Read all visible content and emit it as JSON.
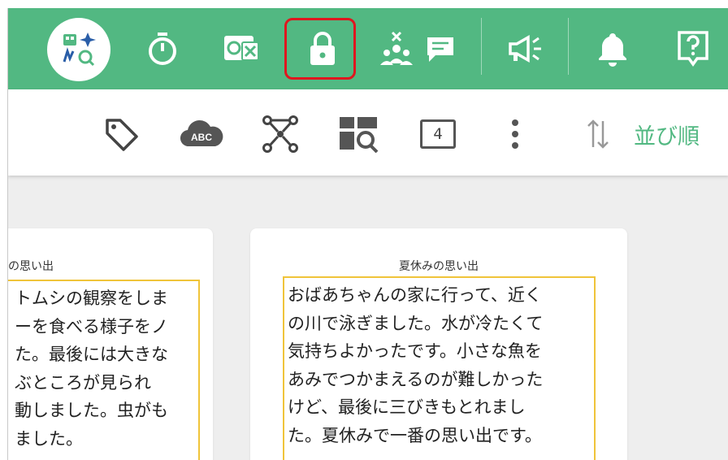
{
  "topbar": {
    "color": "#52b882",
    "icons": [
      "wordcard-logo-icon",
      "stopwatch-icon",
      "close-other-apps-icon",
      "lock-icon",
      "group-remove-chat-icon",
      "announce-icon",
      "bell-icon",
      "help-icon"
    ],
    "highlighted": "lock-icon",
    "highlight_color": "#e0161f"
  },
  "toolbar": {
    "icons": [
      "tag-icon",
      "abc-cloud-icon",
      "connect-nodes-icon",
      "search-grid-icon",
      "number-box-icon",
      "more-vert-icon",
      "sort-icon"
    ],
    "number_box_label": "4",
    "abc_label": "ABC",
    "sort_label": "並び順"
  },
  "cards": [
    {
      "title": "の思い出",
      "lines": [
        "トムシの観察をしま",
        "ーを食べる様子をノ",
        "た。最後には大きな",
        "ぶところが見られ",
        "動しました。虫がも",
        "ました。"
      ]
    },
    {
      "title": "夏休みの思い出",
      "lines": [
        "おばあちゃんの家に行って、近く",
        "の川で泳ぎました。水が冷たくて",
        "気持ちよかったです。小さな魚を",
        "あみでつかまえるのが難しかった",
        "けど、最後に三びきもとれまし",
        "た。夏休みで一番の思い出です。"
      ]
    }
  ]
}
